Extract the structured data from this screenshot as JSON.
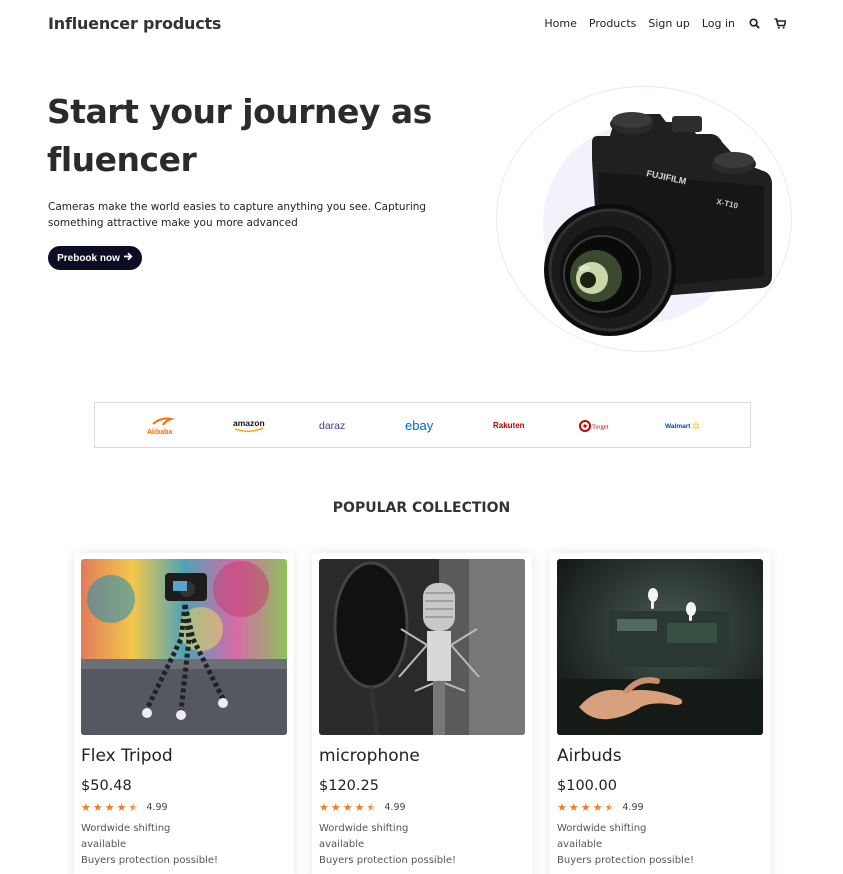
{
  "header": {
    "brand": "Influencer products",
    "nav": [
      "Home",
      "Products",
      "Sign up",
      "Log in"
    ],
    "icons": [
      "search-icon",
      "cart-icon"
    ]
  },
  "hero": {
    "title_line1": "Start your journey as",
    "title_line2": "fluencer",
    "description": "Cameras make the world easies to capture anything you see. Capturing something attractive make you more advanced",
    "cta": "Prebook now",
    "camera_brand": "FUJIFILM",
    "camera_model": "X-T10"
  },
  "partners": [
    "Alibaba",
    "amazon",
    "daraz",
    "ebay",
    "Rakuten",
    "Target",
    "Walmart"
  ],
  "collection": {
    "title": "POPULAR COLLECTION",
    "products": [
      {
        "name": "Flex Tripod",
        "price": "$50.48",
        "rating": "4.99",
        "shipping_line1": "Wordwide shifting",
        "shipping_line2": "available",
        "protection": "Buyers protection possible!"
      },
      {
        "name": "microphone",
        "price": "$120.25",
        "rating": "4.99",
        "shipping_line1": "Wordwide shifting",
        "shipping_line2": "available",
        "protection": "Buyers protection possible!"
      },
      {
        "name": "Airbuds",
        "price": "$100.00",
        "rating": "4.99",
        "shipping_line1": "Wordwide shifting",
        "shipping_line2": "available",
        "protection": "Buyers protection possible!"
      }
    ]
  },
  "colors": {
    "accent_dark": "#0d0d24",
    "star": "#f07d1e",
    "hero_circle": "#f4f0fc"
  }
}
